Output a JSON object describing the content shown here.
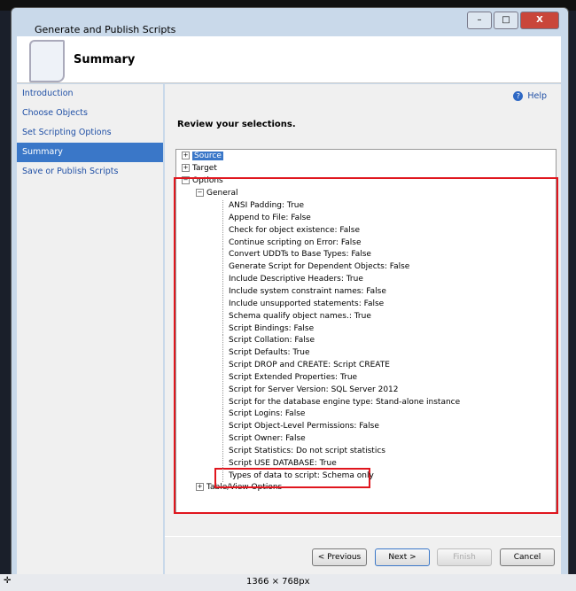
{
  "window": {
    "title": "Generate and Publish Scripts",
    "minimize": "–",
    "maximize": "□",
    "close": "X"
  },
  "header": {
    "title": "Summary"
  },
  "nav": {
    "items": [
      "Introduction",
      "Choose Objects",
      "Set Scripting Options",
      "Summary",
      "Save or Publish Scripts"
    ],
    "selected": 3
  },
  "main": {
    "help": "Help",
    "review": "Review your selections."
  },
  "tree": {
    "source": "Source",
    "target": "Target",
    "options": "Options",
    "general": "General",
    "items": [
      "ANSI Padding: True",
      "Append to File: False",
      "Check for object existence: False",
      "Continue scripting on Error: False",
      "Convert UDDTs to Base Types: False",
      "Generate Script for Dependent Objects: False",
      "Include Descriptive Headers: True",
      "Include system constraint names: False",
      "Include unsupported statements: False",
      "Schema qualify object names.: True",
      "Script Bindings: False",
      "Script Collation: False",
      "Script Defaults: True",
      "Script DROP and CREATE: Script CREATE",
      "Script Extended Properties: True",
      "Script for Server Version: SQL Server 2012",
      "Script for the database engine type: Stand-alone instance",
      "Script Logins: False",
      "Script Object-Level Permissions: False",
      "Script Owner: False",
      "Script Statistics: Do not script statistics",
      "Script USE DATABASE: True",
      "Types of data to script: Schema only"
    ],
    "table_view": "Table/View Options"
  },
  "buttons": {
    "previous": "< Previous",
    "next": "Next >",
    "finish": "Finish",
    "cancel": "Cancel"
  },
  "status": {
    "dimensions": "1366 × 768px"
  },
  "colors": {
    "highlight": "#e0161e",
    "selection": "#3a77c8"
  }
}
